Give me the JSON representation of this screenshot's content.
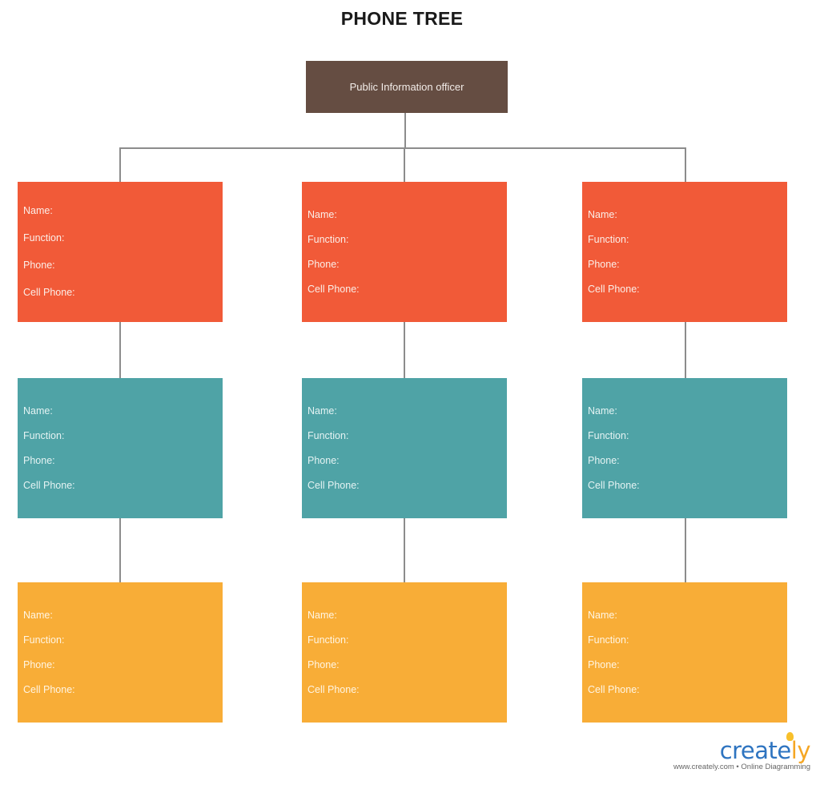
{
  "title": "PHONE TREE",
  "root": {
    "label": "Public Information officer",
    "color": "#654d42"
  },
  "field_labels": [
    "Name:",
    "Function:",
    "Phone:",
    "Cell Phone:"
  ],
  "tiers": [
    {
      "name": "tier-1",
      "color": "#f15a38",
      "boxes": [
        {
          "fields": [
            "Name:",
            "Function:",
            "Phone:",
            "Cell Phone:"
          ]
        },
        {
          "fields": [
            "Name:",
            "Function:",
            "Phone:",
            "Cell Phone:"
          ]
        },
        {
          "fields": [
            "Name:",
            "Function:",
            "Phone:",
            "Cell Phone:"
          ]
        }
      ]
    },
    {
      "name": "tier-2",
      "color": "#4fa3a6",
      "boxes": [
        {
          "fields": [
            "Name:",
            "Function:",
            "Phone:",
            "Cell Phone:"
          ]
        },
        {
          "fields": [
            "Name:",
            "Function:",
            "Phone:",
            "Cell Phone:"
          ]
        },
        {
          "fields": [
            "Name:",
            "Function:",
            "Phone:",
            "Cell Phone:"
          ]
        }
      ]
    },
    {
      "name": "tier-3",
      "color": "#f8ad37",
      "boxes": [
        {
          "fields": [
            "Name:",
            "Function:",
            "Phone:",
            "Cell Phone:"
          ]
        },
        {
          "fields": [
            "Name:",
            "Function:",
            "Phone:",
            "Cell Phone:"
          ]
        },
        {
          "fields": [
            "Name:",
            "Function:",
            "Phone:",
            "Cell Phone:"
          ]
        }
      ]
    }
  ],
  "branding": {
    "logo_main": "create",
    "logo_accent": "ly",
    "tagline": "www.creately.com • Online Diagramming"
  }
}
